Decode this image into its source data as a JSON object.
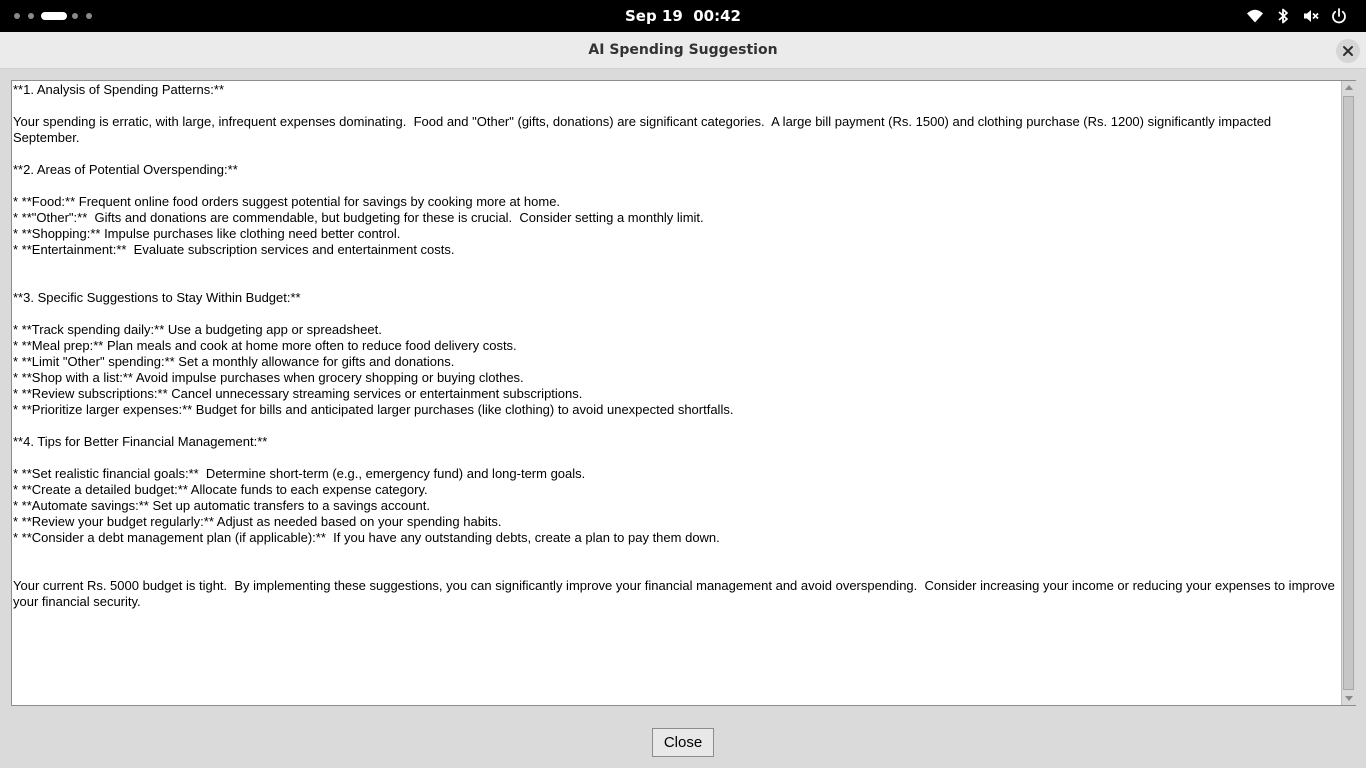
{
  "system_bar": {
    "date": "Sep 19",
    "time": "00:42",
    "tray_icons": [
      "wifi-icon",
      "bluetooth-icon",
      "volume-muted-icon",
      "power-icon"
    ]
  },
  "window": {
    "title": "AI Spending Suggestion",
    "close_button": "Close",
    "content": "**1. Analysis of Spending Patterns:**\n\nYour spending is erratic, with large, infrequent expenses dominating.  Food and \"Other\" (gifts, donations) are significant categories.  A large bill payment (Rs. 1500) and clothing purchase (Rs. 1200) significantly impacted September.\n\n**2. Areas of Potential Overspending:**\n\n* **Food:** Frequent online food orders suggest potential for savings by cooking more at home.\n* **\"Other\":**  Gifts and donations are commendable, but budgeting for these is crucial.  Consider setting a monthly limit.\n* **Shopping:** Impulse purchases like clothing need better control.\n* **Entertainment:**  Evaluate subscription services and entertainment costs.\n\n\n**3. Specific Suggestions to Stay Within Budget:**\n\n* **Track spending daily:** Use a budgeting app or spreadsheet.\n* **Meal prep:** Plan meals and cook at home more often to reduce food delivery costs.\n* **Limit \"Other\" spending:** Set a monthly allowance for gifts and donations.\n* **Shop with a list:** Avoid impulse purchases when grocery shopping or buying clothes.\n* **Review subscriptions:** Cancel unnecessary streaming services or entertainment subscriptions.\n* **Prioritize larger expenses:** Budget for bills and anticipated larger purchases (like clothing) to avoid unexpected shortfalls.\n\n**4. Tips for Better Financial Management:**\n\n* **Set realistic financial goals:**  Determine short-term (e.g., emergency fund) and long-term goals.\n* **Create a detailed budget:** Allocate funds to each expense category.\n* **Automate savings:** Set up automatic transfers to a savings account.\n* **Review your budget regularly:** Adjust as needed based on your spending habits.\n* **Consider a debt management plan (if applicable):**  If you have any outstanding debts, create a plan to pay them down.\n\n\nYour current Rs. 5000 budget is tight.  By implementing these suggestions, you can significantly improve your financial management and avoid overspending.  Consider increasing your income or reducing your expenses to improve your financial security."
  }
}
